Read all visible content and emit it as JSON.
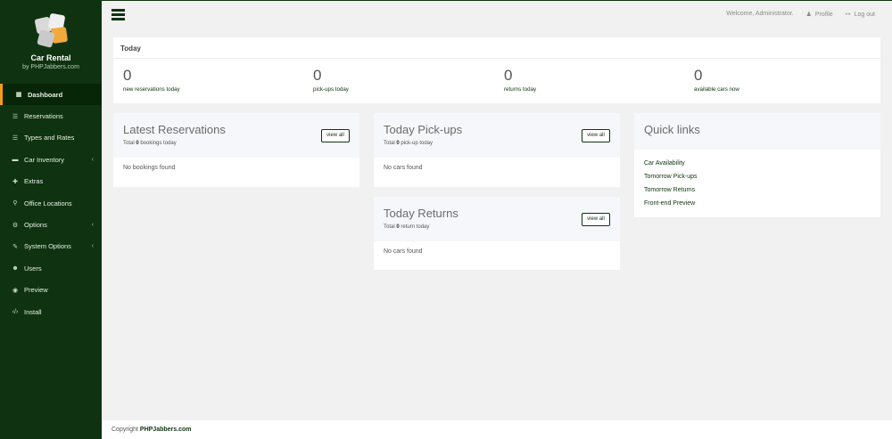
{
  "brand": {
    "title": "Car Rental",
    "subtitle": "by PHPJabbers.com"
  },
  "nav": [
    {
      "label": "Dashboard",
      "icon": "dashboard-icon",
      "active": true,
      "chevron": false
    },
    {
      "label": "Reservations",
      "icon": "list-icon",
      "chevron": false
    },
    {
      "label": "Types and Rates",
      "icon": "list-icon",
      "chevron": false
    },
    {
      "label": "Car Inventory",
      "icon": "car-icon",
      "chevron": true
    },
    {
      "label": "Extras",
      "icon": "plus-icon",
      "chevron": false
    },
    {
      "label": "Office Locations",
      "icon": "location-icon",
      "chevron": false
    },
    {
      "label": "Options",
      "icon": "gears-icon",
      "chevron": true
    },
    {
      "label": "System Options",
      "icon": "wrench-icon",
      "chevron": true
    },
    {
      "label": "Users",
      "icon": "users-icon",
      "chevron": false
    },
    {
      "label": "Preview",
      "icon": "eye-icon",
      "chevron": false
    },
    {
      "label": "Install",
      "icon": "code-icon",
      "chevron": false
    }
  ],
  "topbar": {
    "welcome": "Welcome, Administrator.",
    "profile": "Profile",
    "logout": "Log out"
  },
  "today": {
    "title": "Today",
    "stats": [
      {
        "value": "0",
        "label": "new reservations today"
      },
      {
        "value": "0",
        "label": "pick-ups today"
      },
      {
        "value": "0",
        "label": "returns today"
      },
      {
        "value": "0",
        "label": "available cars now"
      }
    ]
  },
  "latest": {
    "title": "Latest Reservations",
    "sub_pre": "Total ",
    "count": "0",
    "sub_post": " bookings today",
    "view": "view all",
    "empty": "No bookings found"
  },
  "pickups": {
    "title": "Today Pick-ups",
    "sub_pre": "Total ",
    "count": "0",
    "sub_post": " pick-up today",
    "view": "view all",
    "empty": "No cars found"
  },
  "returns": {
    "title": "Today Returns",
    "sub_pre": "Total ",
    "count": "0",
    "sub_post": " return today",
    "view": "view all",
    "empty": "No cars found"
  },
  "quick": {
    "title": "Quick links",
    "links": [
      "Car Availability",
      "Tomorrow Pick-ups",
      "Tomorrow Returns",
      "Front-end Preview"
    ]
  },
  "footer": {
    "prefix": "Copyright ",
    "link": "PHPJabbers.com"
  },
  "colors": {
    "sidebar": "#0f3310",
    "accent": "#f59b1b",
    "link": "#0f3310"
  }
}
